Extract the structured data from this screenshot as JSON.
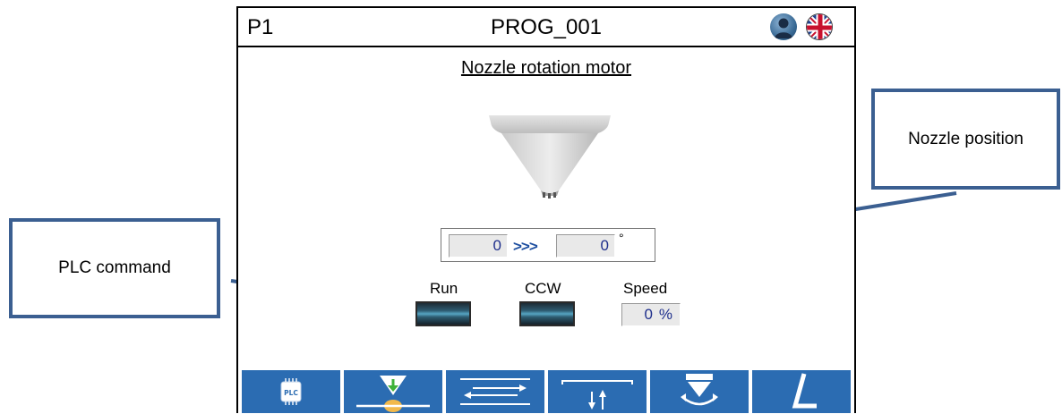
{
  "header": {
    "screen_id": "P1",
    "program_name": "PROG_001",
    "user_icon": "user-icon",
    "language_icon": "uk-flag-icon"
  },
  "screen": {
    "title": "Nozzle rotation motor"
  },
  "position": {
    "actual": "0",
    "arrows": ">>>",
    "target": "0",
    "unit": "°"
  },
  "commands": {
    "run_label": "Run",
    "ccw_label": "CCW",
    "speed_label": "Speed",
    "speed_value": "0",
    "speed_unit": "%"
  },
  "navbar": {
    "buttons": [
      {
        "icon": "plc-icon",
        "text": "PLC"
      },
      {
        "icon": "nozzle-down-icon"
      },
      {
        "icon": "exchange-arrows-icon"
      },
      {
        "icon": "vertical-arrows-icon"
      },
      {
        "icon": "rotation-icon"
      },
      {
        "icon": "angle-icon"
      }
    ]
  },
  "callouts": {
    "plc_command": "PLC command",
    "nozzle_position": "Nozzle position"
  },
  "colors": {
    "nav_blue": "#2b6cb2",
    "value_blue": "#1e2f8c",
    "callout_border": "#3b5f91"
  }
}
